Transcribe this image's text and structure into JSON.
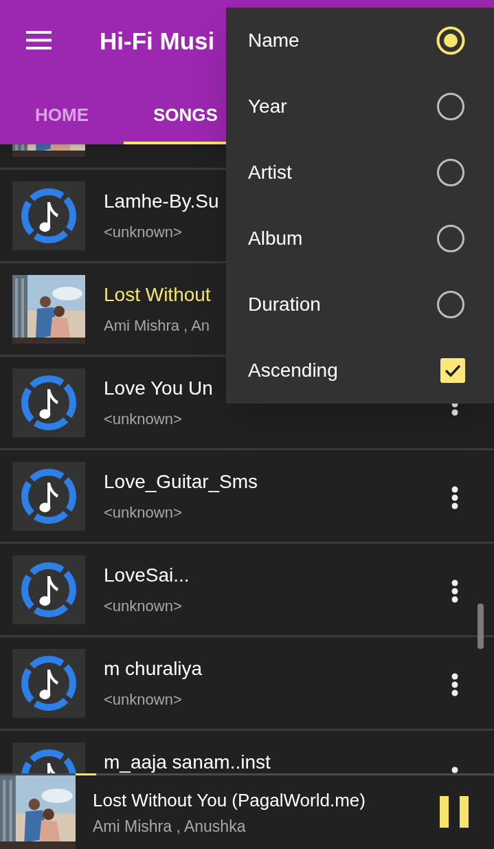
{
  "app_bar": {
    "title": "Hi-Fi Musi"
  },
  "tabs": [
    {
      "label": "HOME",
      "selected": false
    },
    {
      "label": "SONGS",
      "selected": true
    }
  ],
  "songs": [
    {
      "kind": "cover"
    },
    {
      "kind": "note",
      "title": "Lamhe-By.Su",
      "subtitle": "<unknown>",
      "selected": false
    },
    {
      "kind": "cover",
      "title": "Lost Without",
      "subtitle": "Ami Mishra , An",
      "selected": true
    },
    {
      "kind": "note",
      "title": "Love You Un",
      "subtitle": "<unknown>",
      "selected": false
    },
    {
      "kind": "note",
      "title": "Love_Guitar_Sms",
      "subtitle": "<unknown>",
      "selected": false
    },
    {
      "kind": "note",
      "title": "LoveSai...",
      "subtitle": "<unknown>",
      "selected": false
    },
    {
      "kind": "note",
      "title": "m  churaliya",
      "subtitle": "<unknown>",
      "selected": false
    },
    {
      "kind": "note",
      "title": "m_aaja sanam..inst",
      "selected": false
    }
  ],
  "sort_menu": [
    {
      "kind": "radio",
      "label": "Name",
      "selected": true
    },
    {
      "kind": "radio",
      "label": "Year",
      "selected": false
    },
    {
      "kind": "radio",
      "label": "Artist",
      "selected": false
    },
    {
      "kind": "radio",
      "label": "Album",
      "selected": false
    },
    {
      "kind": "radio",
      "label": "Duration",
      "selected": false
    },
    {
      "kind": "checkbox",
      "label": "Ascending",
      "checked": true
    }
  ],
  "now_playing": {
    "title": "Lost Without You (PagalWorld.me)",
    "artist": "Ami Mishra , Anushka",
    "level": 0.05,
    "playing": true
  }
}
